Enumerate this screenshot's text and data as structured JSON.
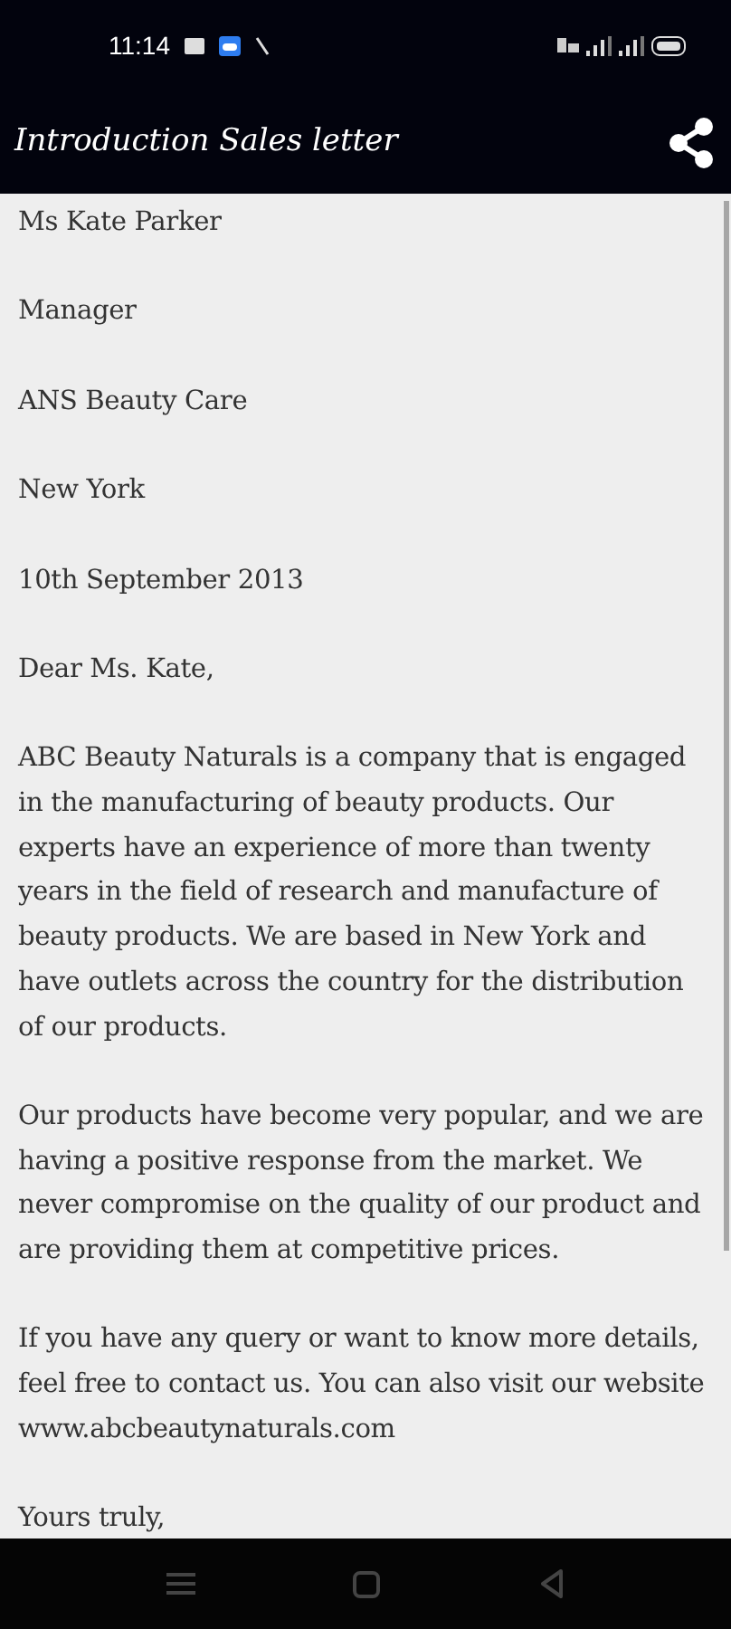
{
  "status_bar": {
    "time": "11:14"
  },
  "app_bar": {
    "title": "Introduction Sales letter"
  },
  "letter": {
    "paragraphs": [
      "Ms Kate Parker",
      "Manager",
      "ANS Beauty Care",
      "New York",
      "10th September 2013",
      "Dear Ms. Kate,",
      "ABC Beauty Naturals is a company that is engaged in the manufacturing of beauty products. Our experts have an experience of more than twenty years in the field of research and manufacture of beauty products. We are based in New York and have outlets across the country for the distribution of our products.",
      "Our products have become very popular, and we are having a positive response from the market. We never compromise on the quality of our product and are providing them at competitive prices.",
      "If you have any query or want to know more details, feel free to contact us. You can also visit our website www.abcbeautynaturals.com",
      "Yours truly,"
    ]
  }
}
